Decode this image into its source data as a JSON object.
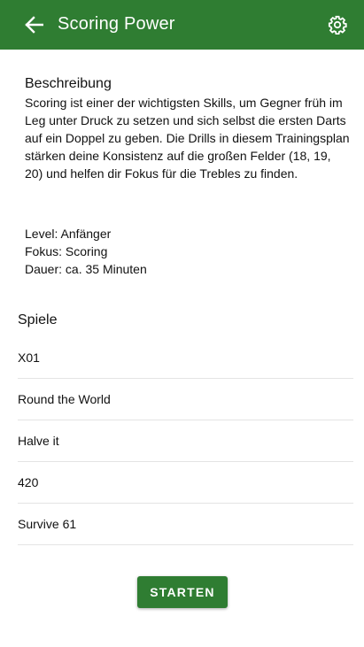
{
  "appbar": {
    "title": "Scoring Power",
    "back_icon": "arrow-left-icon",
    "settings_icon": "gear-icon",
    "color": "#2f7d32"
  },
  "description": {
    "heading": "Beschreibung",
    "text": "Scoring ist einer der wichtigsten Skills, um Gegner früh im Leg unter Druck zu setzen und sich selbst die ersten Darts auf ein Doppel zu geben. Die Drills in diesem Trainingsplan stärken deine Konsistenz auf die großen Felder (18, 19, 20) und helfen dir Fokus für die Trebles zu finden."
  },
  "meta": {
    "level": "Level: Anfänger",
    "focus": "Fokus: Scoring",
    "duration": "Dauer: ca. 35 Minuten"
  },
  "games": {
    "title": "Spiele",
    "items": [
      "X01",
      "Round the World",
      "Halve it",
      "420",
      "Survive 61"
    ]
  },
  "actions": {
    "start_label": "STARTEN"
  }
}
